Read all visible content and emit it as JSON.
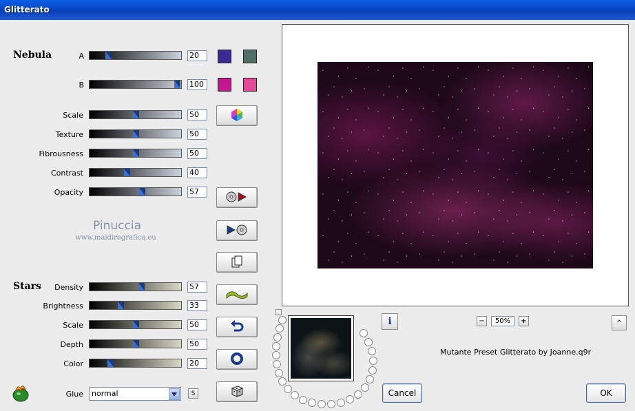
{
  "window": {
    "title": "Glitterato"
  },
  "nebula": {
    "heading": "Nebula",
    "a_label": "A",
    "a_value": "20",
    "b_label": "B",
    "b_value": "100",
    "color_a1": "#3a2a96",
    "color_a2": "#4d6f66",
    "color_b1": "#c4168e",
    "color_b2": "#e04a96",
    "sliders": [
      {
        "label": "Scale",
        "value": "50"
      },
      {
        "label": "Texture",
        "value": "50"
      },
      {
        "label": "Fibrousness",
        "value": "50"
      },
      {
        "label": "Contrast",
        "value": "40"
      },
      {
        "label": "Opacity",
        "value": "57"
      }
    ]
  },
  "watermark": {
    "line1": "Pinuccia",
    "line2": "www.maidiregrafica.eu"
  },
  "stars": {
    "heading": "Stars",
    "sliders": [
      {
        "label": "Density",
        "value": "57"
      },
      {
        "label": "Brightness",
        "value": "33"
      },
      {
        "label": "Scale",
        "value": "50"
      },
      {
        "label": "Depth",
        "value": "50"
      },
      {
        "label": "Color",
        "value": "20"
      }
    ]
  },
  "glue": {
    "label": "Glue",
    "value": "normal",
    "s_label": "S"
  },
  "zoom": {
    "value": "50%",
    "minus": "−",
    "plus": "+"
  },
  "preset_text": "Mutante Preset Glitterato by Joanne.q9r",
  "buttons": {
    "cancel": "Cancel",
    "ok": "OK",
    "info": "i",
    "up": "^"
  }
}
